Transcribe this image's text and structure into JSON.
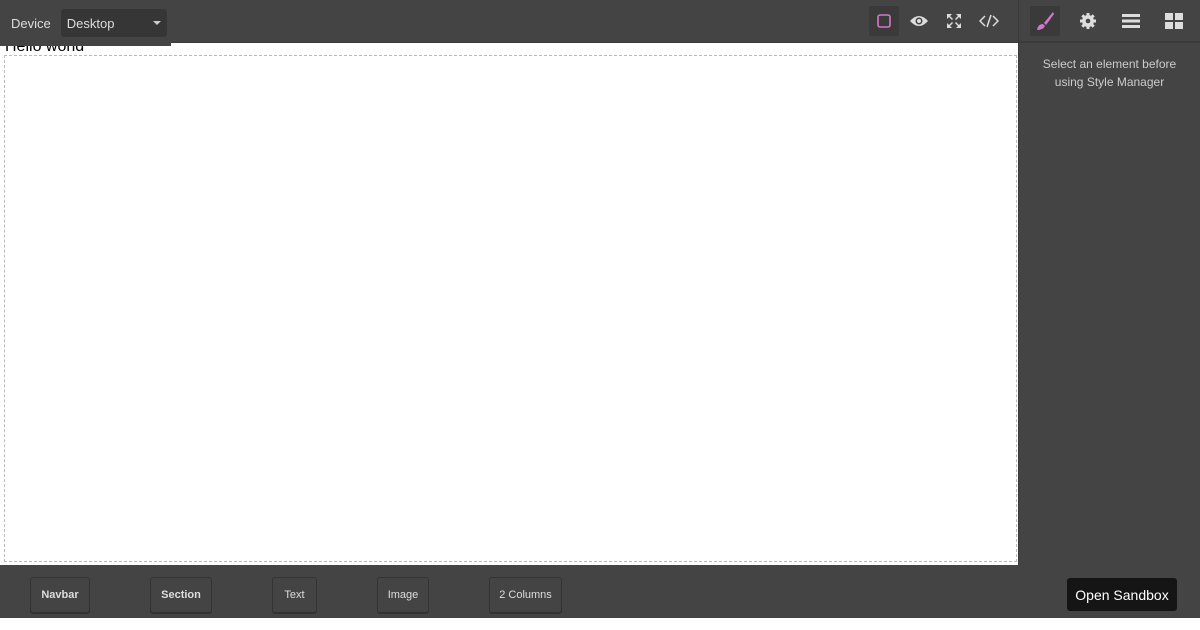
{
  "device": {
    "label": "Device",
    "selected": "Desktop"
  },
  "canvas": {
    "text": "Hello world"
  },
  "style_manager": {
    "message": "Select an element before using Style Manager"
  },
  "blocks": [
    {
      "label": "Navbar"
    },
    {
      "label": "Section"
    },
    {
      "label": "Text"
    },
    {
      "label": "Image"
    },
    {
      "label": "2 Columns"
    }
  ],
  "open_sandbox": "Open Sandbox",
  "colors": {
    "panel": "#444444",
    "accent": "#d278c9"
  }
}
